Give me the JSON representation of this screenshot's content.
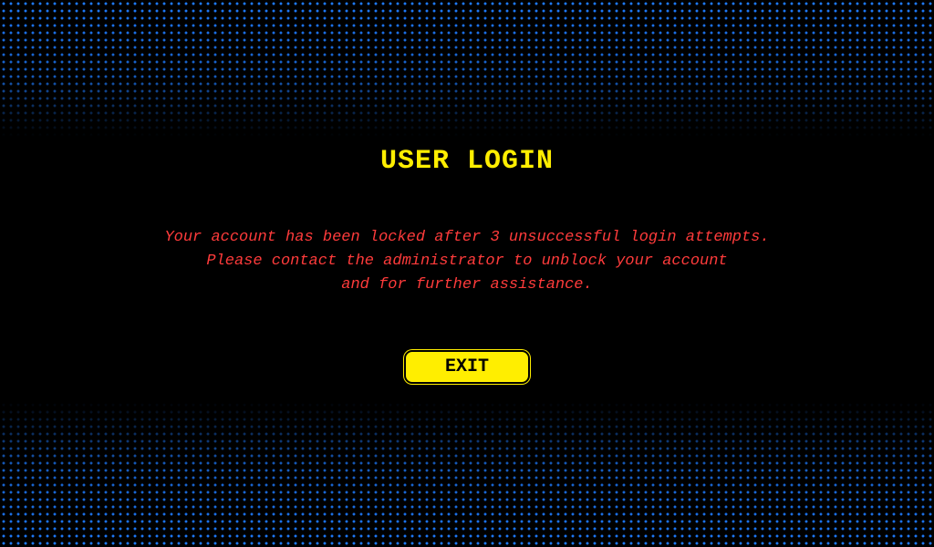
{
  "login": {
    "title": "USER LOGIN",
    "message_lines": [
      "Your account has been locked after 3 unsuccessful login attempts.",
      "Please contact the administrator to unblock your account",
      "and for further assistance."
    ],
    "exit_label": "EXIT"
  },
  "colors": {
    "background": "#000000",
    "title": "#ffee00",
    "message": "#ff3b3b",
    "button_bg": "#ffee00",
    "button_text": "#000000",
    "halftone_dots": "#1e7bff"
  }
}
